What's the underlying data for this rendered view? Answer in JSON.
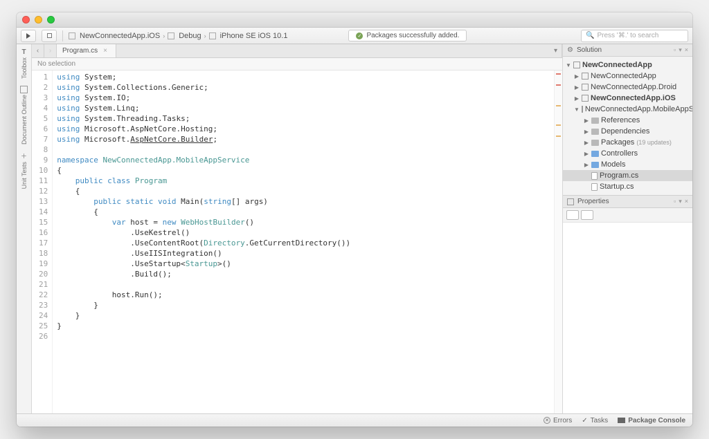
{
  "toolbar": {
    "breadcrumb": {
      "project": "NewConnectedApp.iOS",
      "config": "Debug",
      "device": "iPhone SE iOS 10.1"
    },
    "status_message": "Packages successfully added.",
    "search_placeholder": "Press '⌘.' to search"
  },
  "left_rail": {
    "toolbox": "Toolbox",
    "doc_outline": "Document Outline",
    "unit_tests": "Unit Tests"
  },
  "editor": {
    "tab_name": "Program.cs",
    "crumb": "No selection",
    "lines": [
      {
        "n": 1,
        "html": "<span class='kw'>using</span> System;"
      },
      {
        "n": 2,
        "html": "<span class='kw'>using</span> System.Collections.Generic;"
      },
      {
        "n": 3,
        "html": "<span class='kw'>using</span> System.IO;"
      },
      {
        "n": 4,
        "html": "<span class='kw'>using</span> System.Linq;"
      },
      {
        "n": 5,
        "html": "<span class='kw'>using</span> System.Threading.Tasks;"
      },
      {
        "n": 6,
        "html": "<span class='kw'>using</span> Microsoft.AspNetCore.Hosting;"
      },
      {
        "n": 7,
        "html": "<span class='kw'>using</span> Microsoft.<u>AspNetCore.Builder</u>;"
      },
      {
        "n": 8,
        "html": ""
      },
      {
        "n": 9,
        "html": "<span class='kw'>namespace</span> <span class='type'>NewConnectedApp.MobileAppService</span>"
      },
      {
        "n": 10,
        "html": "{"
      },
      {
        "n": 11,
        "html": "    <span class='kw'>public class</span> <span class='type'>Program</span>"
      },
      {
        "n": 12,
        "html": "    {"
      },
      {
        "n": 13,
        "html": "        <span class='kw'>public static void</span> Main(<span class='kw'>string</span>[] args)"
      },
      {
        "n": 14,
        "html": "        {"
      },
      {
        "n": 15,
        "html": "            <span class='kw'>var</span> host = <span class='kw'>new</span> <span class='type'>WebHostBuilder</span>()"
      },
      {
        "n": 16,
        "html": "                .UseKestrel()"
      },
      {
        "n": 17,
        "html": "                .UseContentRoot(<span class='type'>Directory</span>.GetCurrentDirectory())"
      },
      {
        "n": 18,
        "html": "                .UseIISIntegration()"
      },
      {
        "n": 19,
        "html": "                .UseStartup&lt;<span class='type'>Startup</span>&gt;()"
      },
      {
        "n": 20,
        "html": "                .Build();"
      },
      {
        "n": 21,
        "html": ""
      },
      {
        "n": 22,
        "html": "            host.Run();"
      },
      {
        "n": 23,
        "html": "        }"
      },
      {
        "n": 24,
        "html": "    }"
      },
      {
        "n": 25,
        "html": "}"
      },
      {
        "n": 26,
        "html": ""
      }
    ]
  },
  "solution": {
    "title": "Solution",
    "root": "NewConnectedApp",
    "projects": [
      {
        "name": "NewConnectedApp",
        "bold": false,
        "expanded": false
      },
      {
        "name": "NewConnectedApp.Droid",
        "bold": false,
        "expanded": false
      },
      {
        "name": "NewConnectedApp.iOS",
        "bold": true,
        "expanded": false
      },
      {
        "name": "NewConnectedApp.MobileAppService",
        "bold": false,
        "expanded": true,
        "children": [
          {
            "type": "folder",
            "name": "References",
            "color": "grey"
          },
          {
            "type": "folder",
            "name": "Dependencies",
            "color": "grey"
          },
          {
            "type": "folder",
            "name": "Packages",
            "suffix": "(19 updates)",
            "color": "grey"
          },
          {
            "type": "folder",
            "name": "Controllers",
            "color": "blue"
          },
          {
            "type": "folder",
            "name": "Models",
            "color": "blue"
          },
          {
            "type": "file",
            "name": "Program.cs",
            "selected": true
          },
          {
            "type": "file",
            "name": "Startup.cs"
          }
        ]
      }
    ]
  },
  "properties": {
    "title": "Properties"
  },
  "statusbar": {
    "errors": "Errors",
    "tasks": "Tasks",
    "pkg_console": "Package Console"
  }
}
